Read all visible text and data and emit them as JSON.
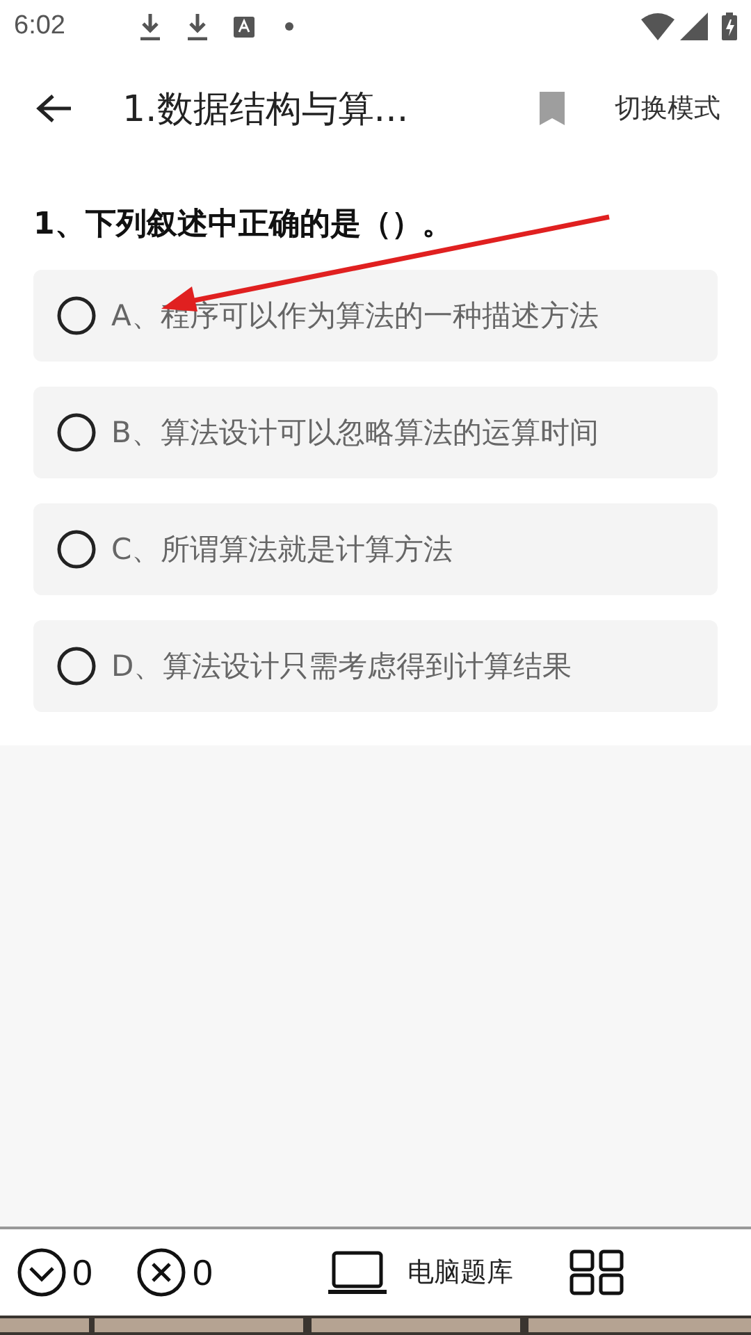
{
  "status_bar": {
    "time": "6:02"
  },
  "header": {
    "title": "1.数据结构与算...",
    "bookmarked": false,
    "mode_button": "切换模式"
  },
  "question": {
    "text": "1、下列叙述中正确的是（）。",
    "options": [
      {
        "label": "A、程序可以作为算法的一种描述方法",
        "selected": false
      },
      {
        "label": "B、算法设计可以忽略算法的运算时间",
        "selected": false
      },
      {
        "label": "C、所谓算法就是计算方法",
        "selected": false
      },
      {
        "label": "D、算法设计只需考虑得到计算结果",
        "selected": false
      }
    ]
  },
  "bottom_bar": {
    "correct_count": "0",
    "wrong_count": "0",
    "computer_bank": "电脑题库"
  }
}
